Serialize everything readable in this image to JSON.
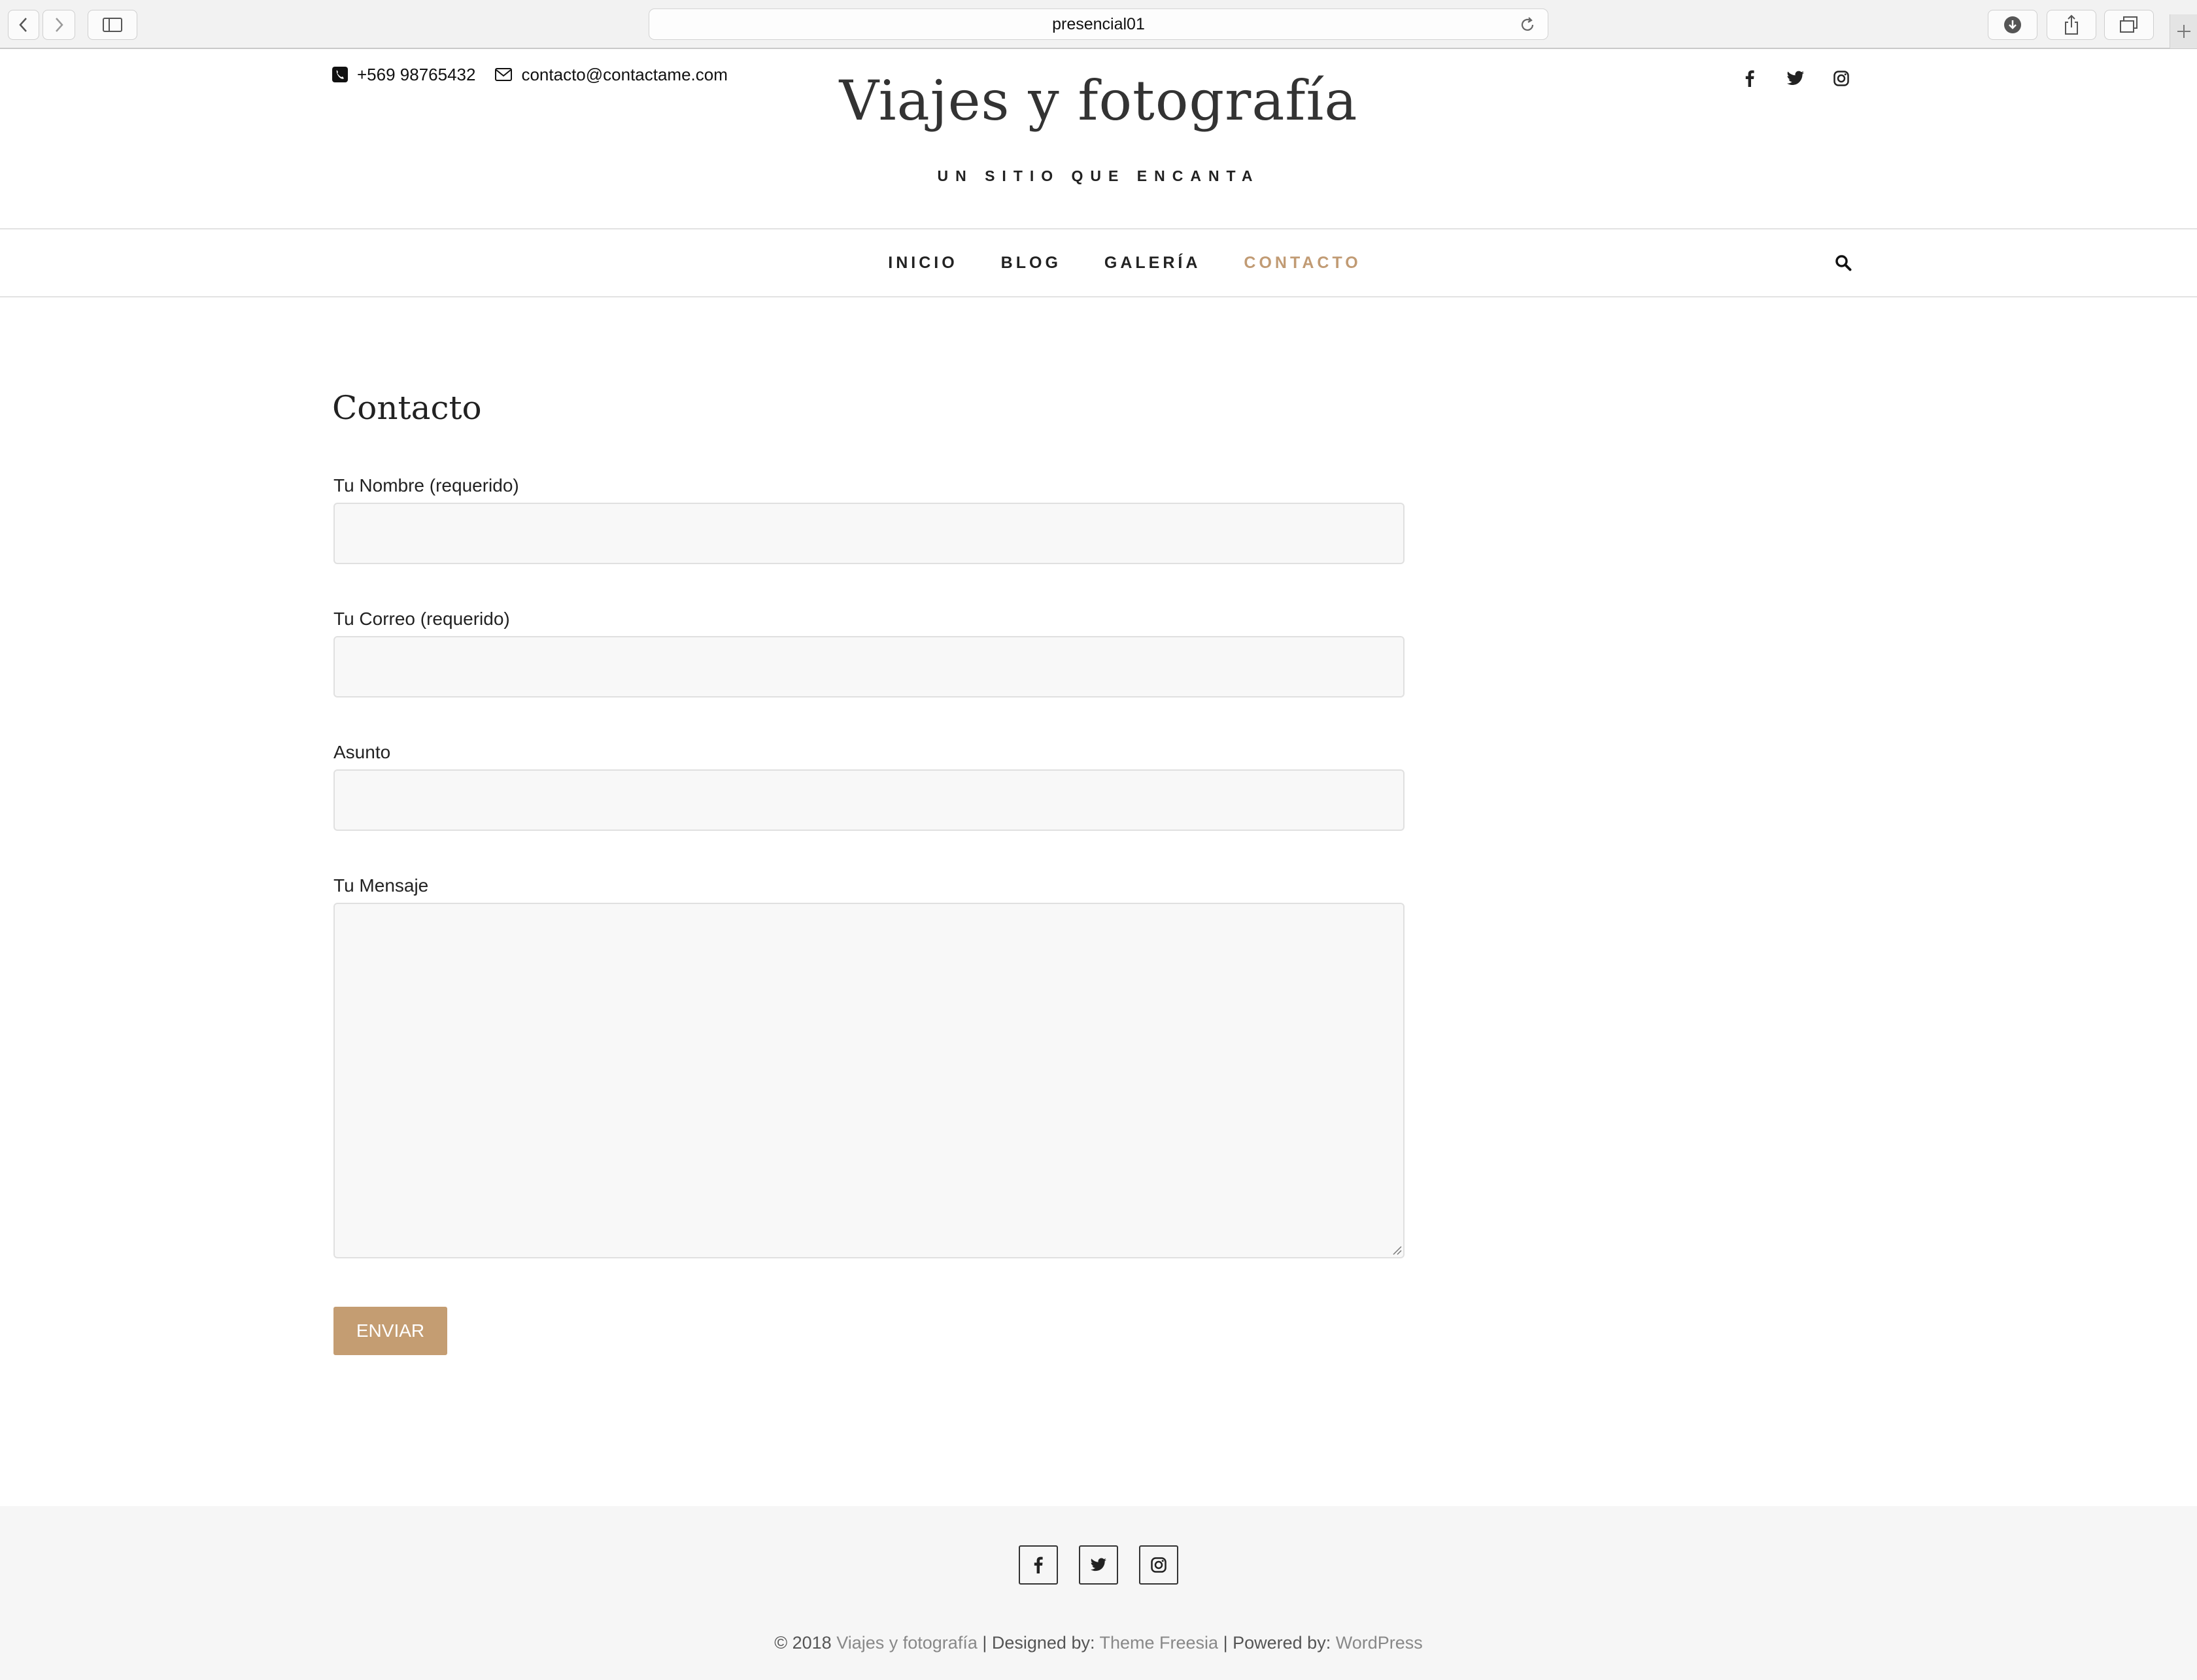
{
  "browser": {
    "url": "presencial01"
  },
  "header": {
    "phone": "+569 98765432",
    "email": "contacto@contactame.com",
    "title": "Viajes y fotografía",
    "tagline": "UN SITIO QUE ENCANTA",
    "social_icons": [
      "facebook-icon",
      "twitter-icon",
      "instagram-icon"
    ]
  },
  "nav": {
    "items": [
      {
        "label": "INICIO"
      },
      {
        "label": "BLOG"
      },
      {
        "label": "GALERÍA"
      },
      {
        "label": "CONTACTO",
        "active": true
      }
    ],
    "search_icon": "search-icon"
  },
  "main": {
    "heading": "Contacto",
    "fields": {
      "name_label": "Tu Nombre (requerido)",
      "email_label": "Tu Correo (requerido)",
      "subject_label": "Asunto",
      "message_label": "Tu Mensaje"
    },
    "submit_label": "ENVIAR"
  },
  "footer": {
    "copyright_prefix": "© 2018",
    "site_link": "Viajes y fotografía",
    "designed_by_label": "| Designed by:",
    "theme_link": "Theme Freesia",
    "powered_by_label": "| Powered by:",
    "platform_link": "WordPress",
    "social_icons": [
      "facebook-icon",
      "twitter-icon",
      "instagram-icon"
    ]
  },
  "colors": {
    "accent": "#c49d72",
    "active_nav": "#c19b74",
    "footer_bg": "#f6f6f6"
  }
}
